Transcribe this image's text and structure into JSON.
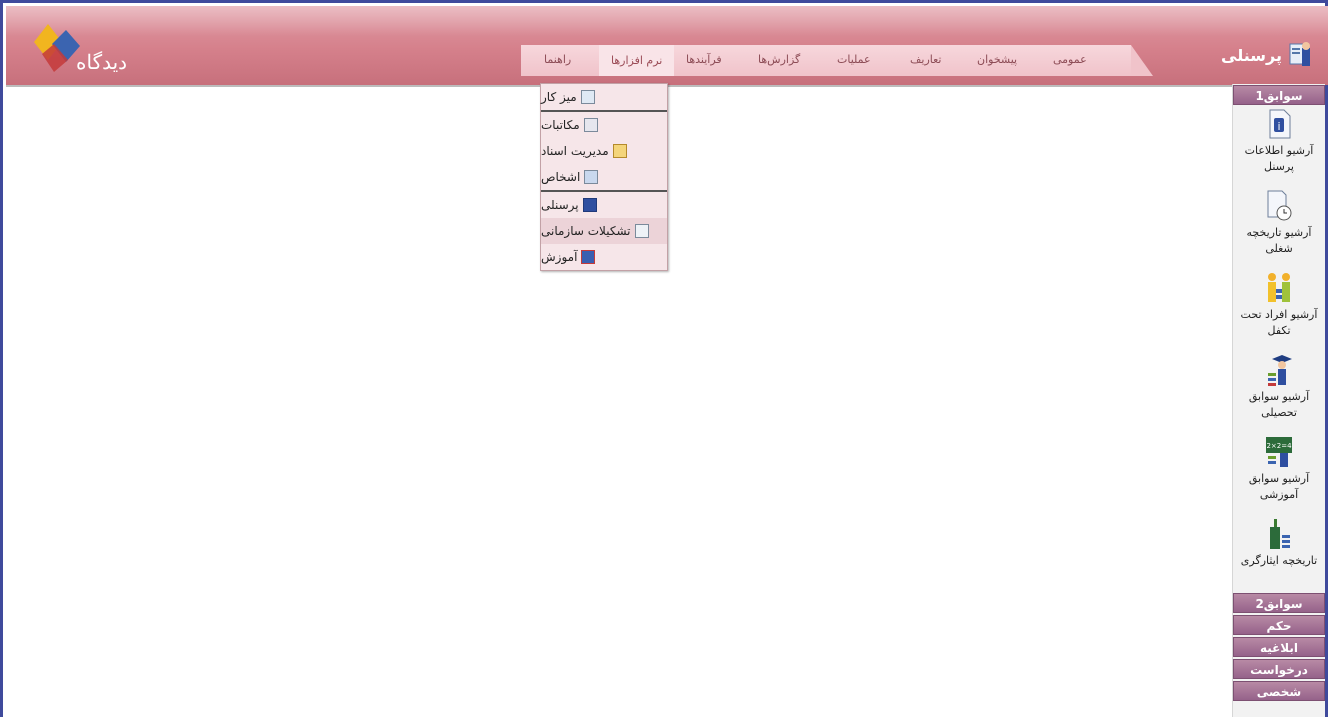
{
  "header": {
    "logo_text": "دیدگاه",
    "app_title": "پرسنلی"
  },
  "menu": {
    "items": [
      "عمومی",
      "پیشخوان",
      "تعاریف",
      "عملیات",
      "گزارش‌ها",
      "فرآیندها",
      "نرم افزارها",
      "راهنما"
    ],
    "active_index": 6
  },
  "dropdown": {
    "items": [
      {
        "label": "میز کار",
        "icon": "desk-icon"
      },
      {
        "label": "مکاتبات",
        "icon": "letters-icon"
      },
      {
        "label": "مدیریت اسناد",
        "icon": "documents-icon"
      },
      {
        "label": "اشخاص",
        "icon": "persons-icon"
      },
      {
        "label": "پرسنلی",
        "icon": "personnel-icon"
      },
      {
        "label": "تشکیلات سازمانی",
        "icon": "org-structure-icon"
      },
      {
        "label": "آموزش",
        "icon": "training-icon"
      }
    ],
    "highlighted_index": 5
  },
  "sidebar": {
    "section1": "سوابق1",
    "items": [
      {
        "label": "آرشیو اطلاعات پرسنل",
        "icon": "info-document-icon"
      },
      {
        "label": "آرشیو تاریخچه شغلی",
        "icon": "clock-document-icon"
      },
      {
        "label": "آرشیو افراد تحت تکفل",
        "icon": "family-icon"
      },
      {
        "label": "آرشیو سوابق تحصیلی",
        "icon": "graduate-icon"
      },
      {
        "label": "آرشیو سوابق آموزشی",
        "icon": "blackboard-icon"
      },
      {
        "label": "تاریخچه ایثارگری",
        "icon": "veteran-icon"
      }
    ],
    "sections": [
      "سوابق2",
      "حکم",
      "ابلاغیه",
      "درخواست",
      "شخصی"
    ]
  }
}
